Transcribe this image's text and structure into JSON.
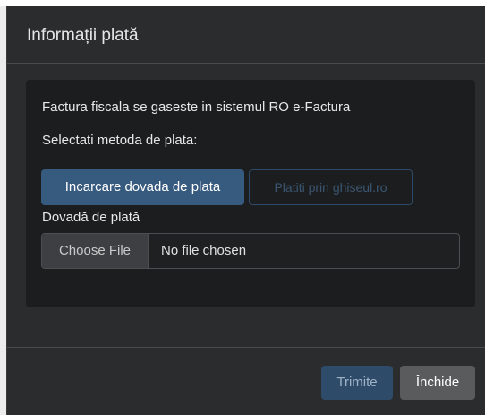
{
  "modal": {
    "title": "Informații plată"
  },
  "body": {
    "info_text": "Factura fiscala se gaseste in sistemul RO e-Factura",
    "method_prompt": "Selectati metoda de plata:",
    "payment_methods": [
      {
        "label": "Incarcare dovada de plata",
        "active": true
      },
      {
        "label": "Platiti prin ghiseul.ro",
        "active": false
      }
    ],
    "file_label": "Dovadă de plată",
    "file_button": "Choose File",
    "file_status": "No file chosen"
  },
  "footer": {
    "submit_label": "Trimite",
    "close_label": "Închide"
  },
  "colors": {
    "accent": "#375a7f",
    "background": "#2b2c2e",
    "card": "#1c1d1f"
  }
}
